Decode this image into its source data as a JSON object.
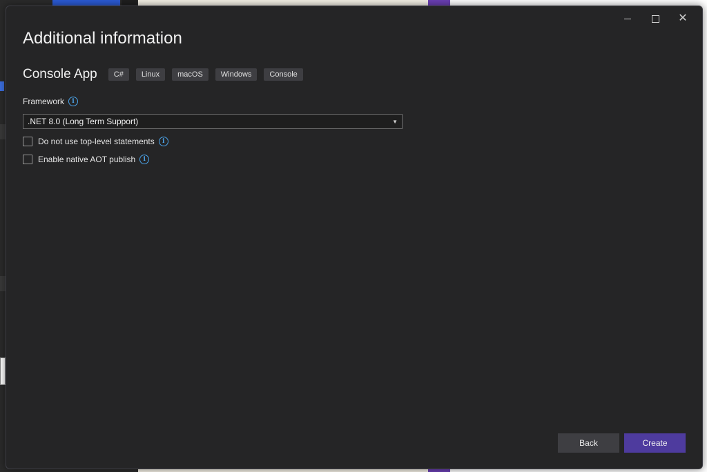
{
  "dialog": {
    "title": "Additional information",
    "template": {
      "name": "Console App",
      "tags": [
        "C#",
        "Linux",
        "macOS",
        "Windows",
        "Console"
      ]
    },
    "framework": {
      "label": "Framework",
      "selected": ".NET 8.0 (Long Term Support)"
    },
    "options": [
      {
        "label": "Do not use top-level statements",
        "checked": false
      },
      {
        "label": "Enable native AOT publish",
        "checked": false
      }
    ],
    "buttons": {
      "back": "Back",
      "create": "Create"
    },
    "window_controls": {
      "minimize": "—",
      "maximize": "",
      "close": "✕"
    }
  },
  "colors": {
    "dialog_bg": "#252526",
    "accent_create": "#4e3b9e",
    "info_icon": "#4ba3e8"
  }
}
